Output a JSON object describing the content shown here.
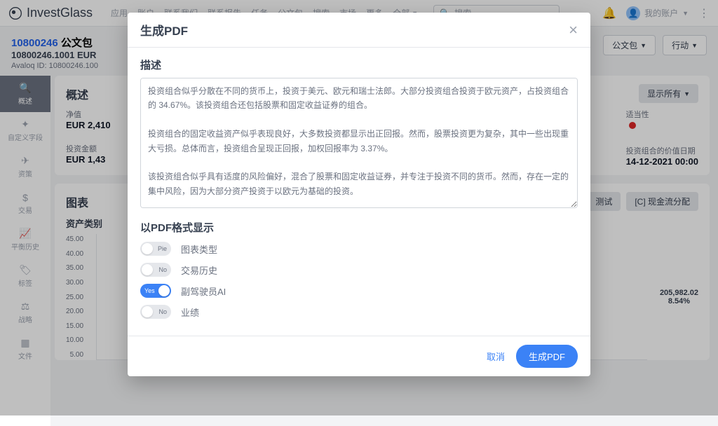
{
  "brand": "InvestGlass",
  "nav": {
    "items": [
      "应用",
      "账户",
      "联系我们",
      "联系报告",
      "任务",
      "公文包",
      "搜索",
      "市场",
      "更多"
    ],
    "all_dropdown": "全部",
    "search_placeholder": "搜索",
    "account_label": "我的账户"
  },
  "page_header": {
    "id": "10800246",
    "id_suffix": "公文包",
    "line2": "10800246.1001 EUR",
    "line3_prefix": "Avaloq ID:",
    "line3_value": "10800246.100",
    "btn_portfolio": "公文包",
    "btn_action": "行动"
  },
  "sidebar": {
    "items": [
      {
        "icon": "🔍",
        "label": "概述",
        "active": true
      },
      {
        "icon": "✦",
        "label": "自定义字段"
      },
      {
        "icon": "✈",
        "label": "资策"
      },
      {
        "icon": "$",
        "label": "交易"
      },
      {
        "icon": "📈",
        "label": "平衡历史"
      },
      {
        "icon": "🏷",
        "label": "标签"
      },
      {
        "icon": "⚖",
        "label": "战略"
      },
      {
        "icon": "▦",
        "label": "文件"
      }
    ]
  },
  "overview": {
    "title": "概述",
    "show_all": "显示所有",
    "stats": {
      "net_label": "净值",
      "net_value": "EUR 2,410",
      "invest_label": "投资金额",
      "invest_value": "EUR 1,43",
      "suitability_label": "适当性",
      "date_label": "投资组合的价值日期",
      "date_value": "14-12-2021 00:00"
    }
  },
  "chart": {
    "title": "图表",
    "tabs": {
      "test": "测试",
      "cashflow": "[C] 现金流分配"
    },
    "subtitle": "资产类别",
    "yaxis": [
      "45.00",
      "40.00",
      "35.00",
      "30.00",
      "25.00",
      "20.00",
      "15.00",
      "10.00",
      "5.00"
    ],
    "labels": {
      "l1": "20.00",
      "l2": "10.00"
    },
    "side_stat": {
      "value": "205,982.02",
      "pct": "8.54%"
    }
  },
  "modal": {
    "title": "生成PDF",
    "desc_label": "描述",
    "desc_text": "投资组合似乎分散在不同的货币上，投资于美元、欧元和瑞士法郎。大部分投资组合投资于欧元资产，占投资组合的 34.67%。该投资组合还包括股票和固定收益证券的组合。\n\n投资组合的固定收益资产似乎表现良好，大多数投资都显示出正回报。然而，股票投资更为复杂，其中一些出现重大亏损。总体而言，投资组合呈现正回报，加权回报率为 3.37%。\n\n该投资组合似乎具有适度的风险偏好，混合了股票和固定收益证券，并专注于投资不同的货币。然而，存在一定的集中风险，因为大部分资产投资于以欧元为基础的投资。\n\n了解更多有关投资组合的投资目标、投资期限和风险承受能力的信息，有助于提供更详细的分析。",
    "show_as_label": "以PDF格式显示",
    "toggles": [
      {
        "state": "off",
        "text": "Pie",
        "label": "图表类型"
      },
      {
        "state": "off",
        "text": "No",
        "label": "交易历史"
      },
      {
        "state": "on",
        "text": "Yes",
        "label": "副驾驶员AI"
      },
      {
        "state": "off",
        "text": "No",
        "label": "业绩"
      }
    ],
    "cancel": "取消",
    "generate": "生成PDF"
  }
}
